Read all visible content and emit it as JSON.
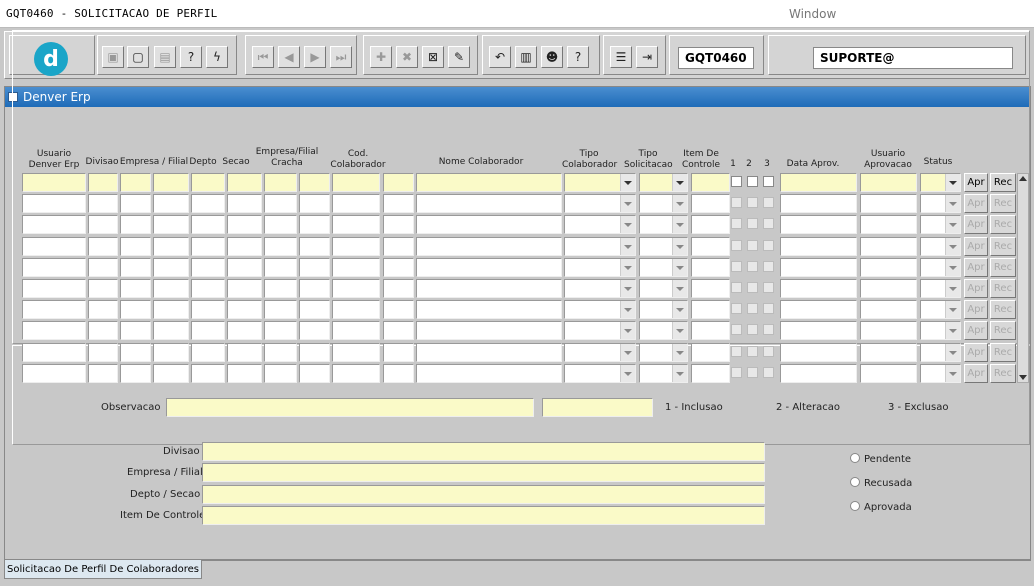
{
  "app_title": "GQT0460 - SOLICITACAO DE PERFIL",
  "window_menu": "Window",
  "toolbar": {
    "logo_letter": "d",
    "form_code": "GQT0460",
    "user": "SUPORTE@"
  },
  "window": {
    "title": "Denver Erp"
  },
  "columns": {
    "usuario": "Usuario Denver Erp",
    "divisao": "Divisao",
    "empresa_filial": "Empresa / Filial",
    "depto": "Depto",
    "secao": "Secao",
    "empresa_filial_cracha": "Empresa/Filial Cracha",
    "cod_colaborador": "Cod. Colaborador",
    "nome_colaborador": "Nome Colaborador",
    "tipo_colaborador": "Tipo Colaborador",
    "tipo_solicitacao": "Tipo Solicitacao",
    "item_controle": "Item De Controle",
    "c1": "1",
    "c2": "2",
    "c3": "3",
    "data_aprov": "Data Aprov.",
    "usuario_aprovacao": "Usuario Aprovacao",
    "status": "Status"
  },
  "row_buttons": {
    "apr": "Apr",
    "rec": "Rec"
  },
  "row_count": 10,
  "observacao": {
    "label": "Observacao",
    "legend1": "1 - Inclusao",
    "legend2": "2 - Alteracao",
    "legend3": "3 - Exclusao"
  },
  "details": {
    "divisao": "Divisao",
    "empresa_filial": "Empresa / Filial",
    "depto_secao": "Depto / Secao",
    "item_controle": "Item De Controle"
  },
  "status_radios": {
    "pendente": "Pendente",
    "recusada": "Recusada",
    "aprovada": "Aprovada"
  },
  "tab": "Solicitacao De Perfil De Colaboradores"
}
